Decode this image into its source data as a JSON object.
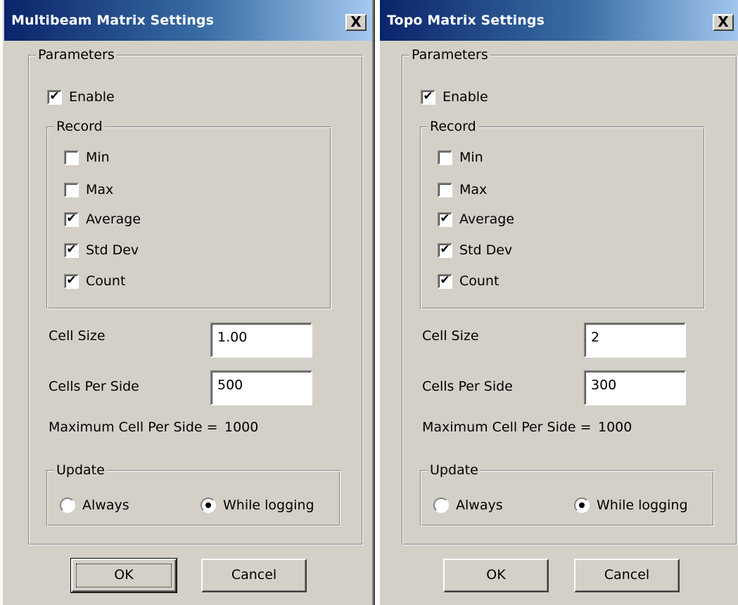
{
  "dialogs": [
    {
      "title": "Multibeam Matrix Settings",
      "close_label": "X",
      "parameters": {
        "legend": "Parameters",
        "enable": {
          "label": "Enable",
          "checked": true
        },
        "record": {
          "legend": "Record",
          "items": [
            {
              "label": "Min",
              "checked": false
            },
            {
              "label": "Max",
              "checked": false
            },
            {
              "label": "Average",
              "checked": true
            },
            {
              "label": "Std Dev",
              "checked": true
            },
            {
              "label": "Count",
              "checked": true
            }
          ]
        },
        "cell_size": {
          "label": "Cell Size",
          "value": "1.00"
        },
        "cells_per_side": {
          "label": "Cells Per Side",
          "value": "500"
        },
        "max_cells": {
          "label": "Maximum Cell Per Side =",
          "value": "1000"
        },
        "update": {
          "legend": "Update",
          "always": {
            "label": "Always",
            "selected": false
          },
          "while_logging": {
            "label": "While logging",
            "selected": true
          }
        }
      },
      "ok_label": "OK",
      "cancel_label": "Cancel"
    },
    {
      "title": "Topo Matrix Settings",
      "close_label": "X",
      "parameters": {
        "legend": "Parameters",
        "enable": {
          "label": "Enable",
          "checked": true
        },
        "record": {
          "legend": "Record",
          "items": [
            {
              "label": "Min",
              "checked": false
            },
            {
              "label": "Max",
              "checked": false
            },
            {
              "label": "Average",
              "checked": true
            },
            {
              "label": "Std Dev",
              "checked": true
            },
            {
              "label": "Count",
              "checked": true
            }
          ]
        },
        "cell_size": {
          "label": "Cell Size",
          "value": "2"
        },
        "cells_per_side": {
          "label": "Cells Per Side",
          "value": "300"
        },
        "max_cells": {
          "label": "Maximum Cell Per Side =",
          "value": "1000"
        },
        "update": {
          "legend": "Update",
          "always": {
            "label": "Always",
            "selected": false
          },
          "while_logging": {
            "label": "While logging",
            "selected": true
          }
        }
      },
      "ok_label": "OK",
      "cancel_label": "Cancel"
    }
  ],
  "check_glyph": "✔"
}
